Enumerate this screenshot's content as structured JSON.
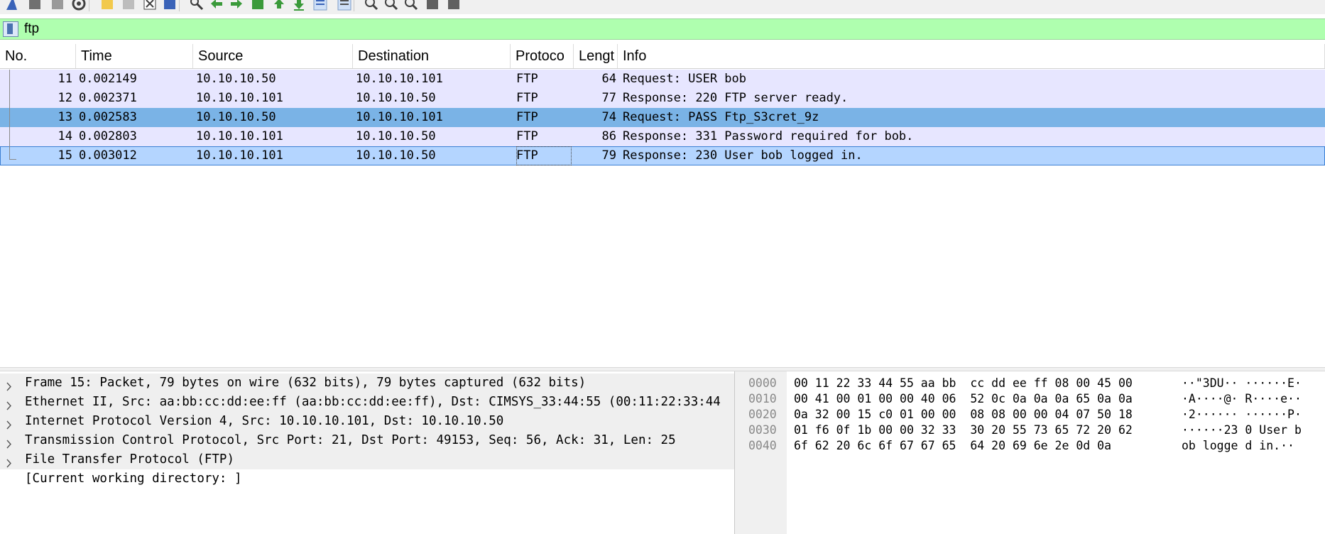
{
  "toolbar": {
    "icons": [
      "shark-fin-start-icon",
      "stop-capture-icon",
      "restart-capture-icon",
      "capture-options-icon",
      "open-file-icon",
      "save-file-icon",
      "close-file-icon",
      "reload-file-icon",
      "find-packet-icon",
      "go-back-icon",
      "go-forward-icon",
      "go-to-packet-icon",
      "go-first-packet-icon",
      "go-last-packet-icon",
      "auto-scroll-icon",
      "colorize-icon",
      "zoom-in-icon",
      "zoom-out-icon",
      "zoom-normal-icon",
      "resize-columns-icon",
      "layout-icon"
    ]
  },
  "filter": {
    "value": "ftp",
    "bg_color": "#afffaf"
  },
  "packet_list": {
    "columns": [
      "No.",
      "Time",
      "Source",
      "Destination",
      "Protoco",
      "Lengt",
      "Info"
    ],
    "rows": [
      {
        "no": "11",
        "time": "0.002149",
        "source": "10.10.10.50",
        "destination": "10.10.10.101",
        "protocol": "FTP",
        "length": "64",
        "info": "Request: USER bob",
        "state": "normal"
      },
      {
        "no": "12",
        "time": "0.002371",
        "source": "10.10.10.101",
        "destination": "10.10.10.50",
        "protocol": "FTP",
        "length": "77",
        "info": "Response: 220 FTP server ready.",
        "state": "normal"
      },
      {
        "no": "13",
        "time": "0.002583",
        "source": "10.10.10.50",
        "destination": "10.10.10.101",
        "protocol": "FTP",
        "length": "74",
        "info": "Request: PASS Ftp_S3cret_9z",
        "state": "related"
      },
      {
        "no": "14",
        "time": "0.002803",
        "source": "10.10.10.101",
        "destination": "10.10.10.50",
        "protocol": "FTP",
        "length": "86",
        "info": "Response: 331 Password required for bob.",
        "state": "normal"
      },
      {
        "no": "15",
        "time": "0.003012",
        "source": "10.10.10.101",
        "destination": "10.10.10.50",
        "protocol": "FTP",
        "length": "79",
        "info": "Response: 230 User bob logged in.",
        "state": "selected"
      }
    ],
    "colors": {
      "normal": "#e7e6ff",
      "related": "#7ab3e6",
      "selected": "#b4d5ff"
    }
  },
  "details": {
    "items": [
      {
        "text": "Frame 15: Packet, 79 bytes on wire (632 bits), 79 bytes captured (632 bits)",
        "expandable": true
      },
      {
        "text": "Ethernet II, Src: aa:bb:cc:dd:ee:ff (aa:bb:cc:dd:ee:ff), Dst: CIMSYS_33:44:55 (00:11:22:33:44",
        "expandable": true
      },
      {
        "text": "Internet Protocol Version 4, Src: 10.10.10.101, Dst: 10.10.10.50",
        "expandable": true
      },
      {
        "text": "Transmission Control Protocol, Src Port: 21, Dst Port: 49153, Seq: 56, Ack: 31, Len: 25",
        "expandable": true
      },
      {
        "text": "File Transfer Protocol (FTP)",
        "expandable": true
      },
      {
        "text": "[Current working directory: ]",
        "expandable": false
      }
    ]
  },
  "bytes": {
    "rows": [
      {
        "offset": "0000",
        "hex": "00 11 22 33 44 55 aa bb  cc dd ee ff 08 00 45 00",
        "ascii": "··\"3DU·· ······E·"
      },
      {
        "offset": "0010",
        "hex": "00 41 00 01 00 00 40 06  52 0c 0a 0a 0a 65 0a 0a",
        "ascii": "·A····@· R····e··"
      },
      {
        "offset": "0020",
        "hex": "0a 32 00 15 c0 01 00 00  08 08 00 00 04 07 50 18",
        "ascii": "·2······ ······P·"
      },
      {
        "offset": "0030",
        "hex": "01 f6 0f 1b 00 00 32 33  30 20 55 73 65 72 20 62",
        "ascii": "······23 0 User b"
      },
      {
        "offset": "0040",
        "hex": "6f 62 20 6c 6f 67 67 65  64 20 69 6e 2e 0d 0a",
        "ascii": "ob logge d in.··"
      }
    ]
  }
}
